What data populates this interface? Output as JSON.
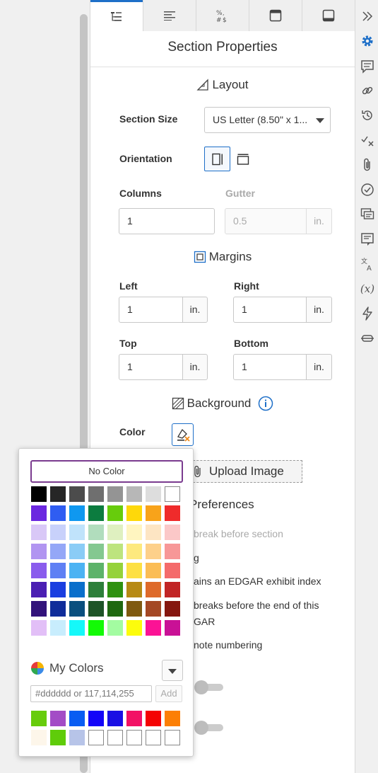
{
  "panel": {
    "tabs": [
      {
        "name": "section-structure",
        "active": true
      },
      {
        "name": "paragraph",
        "active": false
      },
      {
        "name": "number-format",
        "active": false
      },
      {
        "name": "header",
        "active": false
      },
      {
        "name": "footer",
        "active": false
      }
    ],
    "title": "Section Properties",
    "layout": {
      "heading": "Layout",
      "section_size_label": "Section Size",
      "section_size_value": "US Letter (8.50\" x 1...",
      "orientation_label": "Orientation",
      "orientation_selected": "portrait",
      "columns_label": "Columns",
      "columns_value": "1",
      "gutter_label": "Gutter",
      "gutter_value": "0.5",
      "gutter_unit": "in."
    },
    "margins": {
      "heading": "Margins",
      "left_label": "Left",
      "left_value": "1",
      "left_unit": "in.",
      "right_label": "Right",
      "right_value": "1",
      "right_unit": "in.",
      "top_label": "Top",
      "top_value": "1",
      "top_unit": "in.",
      "bottom_label": "Bottom",
      "bottom_value": "1",
      "bottom_unit": "in."
    },
    "background": {
      "heading": "Background",
      "color_label": "Color",
      "upload_label": "Upload Image"
    },
    "preferences": {
      "heading": "Preferences",
      "line1": "break before section",
      "line2": "g",
      "line3": "ains an EDGAR exhibit index",
      "line4": "breaks before the end of this",
      "line5": "GAR",
      "line6": "note numbering"
    }
  },
  "color_picker": {
    "no_color_label": "No Color",
    "palette": [
      [
        "#000000",
        "#262626",
        "#4c4c4c",
        "#6f6f6f",
        "#949494",
        "#b7b7b7",
        "#dddddd",
        "#ffffff"
      ],
      [
        "#6b28e0",
        "#2f5df2",
        "#0f98f0",
        "#0c7c3f",
        "#67cc0c",
        "#fed80a",
        "#f8a31a",
        "#ef2b2b"
      ],
      [
        "#d9c8f7",
        "#c8d1fb",
        "#c0e3fb",
        "#b1ddbd",
        "#dff0c0",
        "#fff5c0",
        "#fde5c3",
        "#fbc8c8"
      ],
      [
        "#b195f1",
        "#94a7f7",
        "#8accf6",
        "#84c890",
        "#bde47e",
        "#fde97e",
        "#fdd08a",
        "#f79797"
      ],
      [
        "#8a5ced",
        "#5f80f4",
        "#4cb3f3",
        "#5db36a",
        "#95d23a",
        "#fde043",
        "#fbbd55",
        "#f46a6a"
      ],
      [
        "#4b1fb3",
        "#1a3ee0",
        "#0a6fcb",
        "#2d7f3a",
        "#2f9110",
        "#b78a14",
        "#de6a2a",
        "#c12525"
      ],
      [
        "#32137b",
        "#102d9a",
        "#0a4f7e",
        "#1e5427",
        "#1f6810",
        "#7f5a10",
        "#a44824",
        "#85170f"
      ],
      [
        "#e2bff7",
        "#c8edfd",
        "#15f8f9",
        "#13fa06",
        "#a3fca1",
        "#fcfc0c",
        "#fb1295",
        "#c91196"
      ]
    ],
    "my_colors_label": "My Colors",
    "hex_placeholder": "#dddddd or 117,114,255",
    "add_label": "Add",
    "my_colors": [
      [
        "#67cc0c",
        "#a34cc6",
        "#0a5df2",
        "#1404f8",
        "#1a0fe4",
        "#f21165",
        "#f40303",
        "#fc7f05"
      ],
      [
        "#fdf6ea",
        "#5fcc0a",
        "#b7c4e8",
        "#ffffff",
        "#ffffff",
        "#ffffff",
        "#ffffff",
        "#ffffff"
      ]
    ]
  },
  "right_rail": {
    "icons": [
      "collapse-icon",
      "settings-icon",
      "comment-icon",
      "link-icon",
      "history-icon",
      "track-changes-icon",
      "attachment-icon",
      "check-circle-icon",
      "compare-icon",
      "notes-icon",
      "translate-icon",
      "variable-icon",
      "lightning-icon",
      "connector-icon"
    ],
    "variable_label": "(x)"
  }
}
